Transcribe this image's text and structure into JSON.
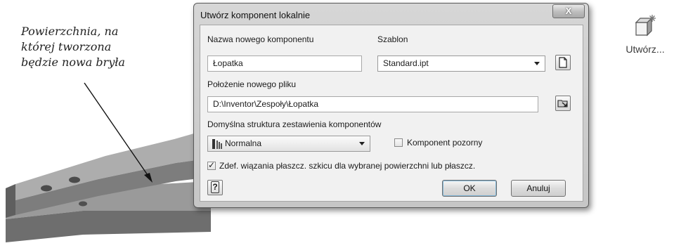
{
  "caption": {
    "lines": [
      "Powierzchnia, na",
      "której tworzona",
      "będzie nowa bryła"
    ]
  },
  "ribbon": {
    "create_label": "Utwórz...",
    "create_icon": "create-component-icon"
  },
  "dialog": {
    "title": "Utwórz komponent lokalnie",
    "close_glyph": "X",
    "name_label": "Nazwa nowego komponentu",
    "name_value": "Łopatka",
    "template_label": "Szablon",
    "template_value": "Standard.ipt",
    "location_label": "Położenie nowego pliku",
    "location_value": "D:\\Inventor\\Zespoły\\Łopatka",
    "bom_label": "Domyślna struktura zestawienia komponentów",
    "bom_value": "Normalna",
    "virtual_label": "Komponent pozorny",
    "virtual_checked": false,
    "constrain_label": "Zdef. wiązania płaszcz. szkicu dla wybranej powierzchni lub płaszcz.",
    "constrain_checked": true,
    "help_glyph": "?",
    "ok_label": "OK",
    "cancel_label": "Anuluj"
  },
  "colors": {
    "part_top": "#a4a4a4",
    "part_side": "#767676",
    "dialog_frame": "#cbcbcb",
    "client_bg": "#f1f1f1"
  }
}
